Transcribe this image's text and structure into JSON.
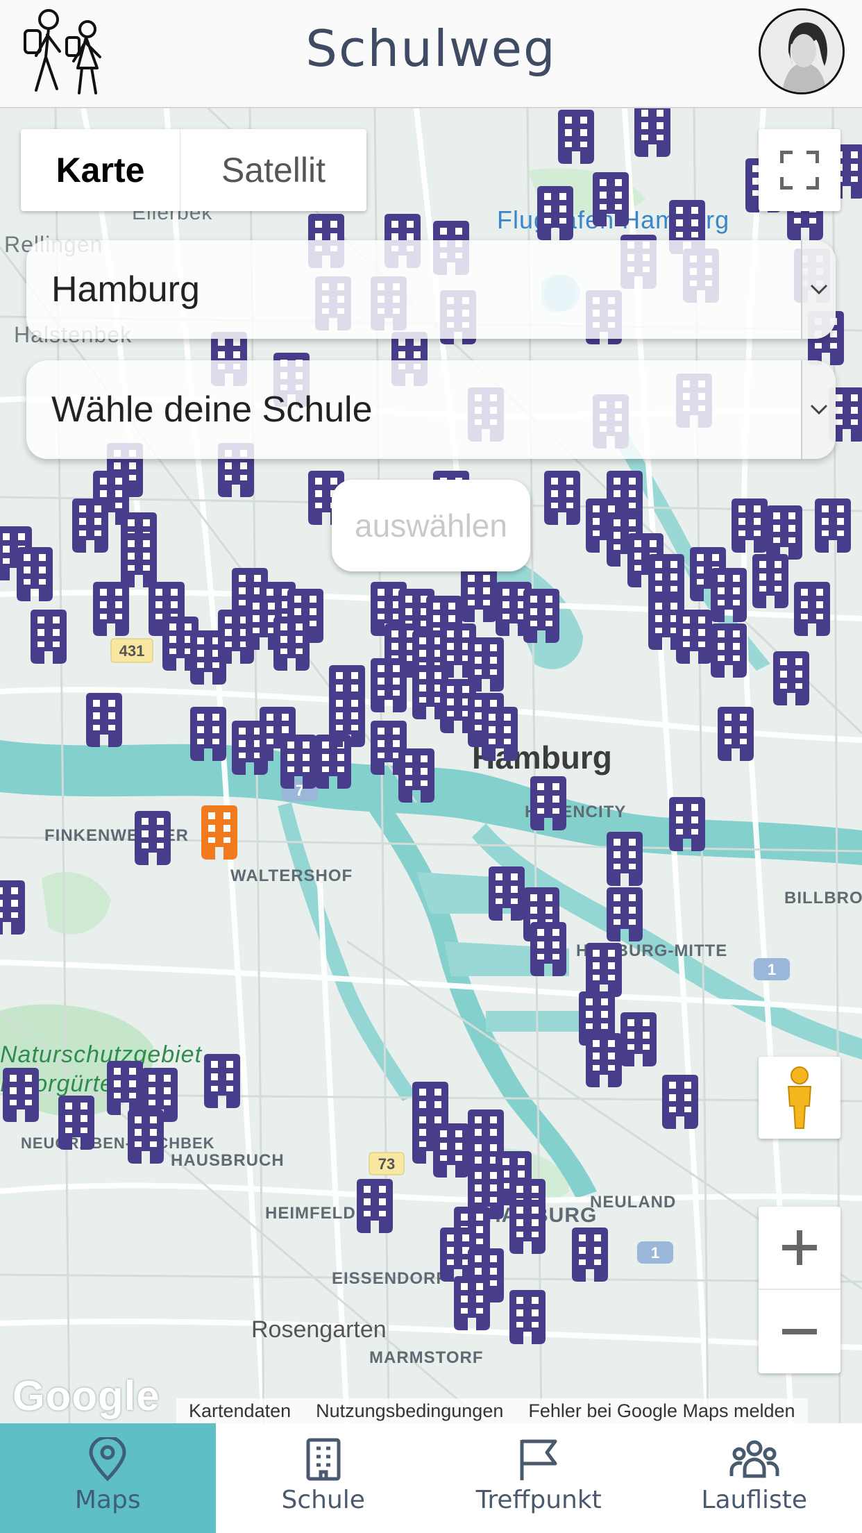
{
  "header": {
    "title": "Schulweg"
  },
  "map": {
    "map_type_buttons": [
      "Karte",
      "Satellit"
    ],
    "city_select_value": "Hamburg",
    "school_select_placeholder": "Wähle deine Schule",
    "choose_button_label": "auswählen",
    "place_labels": [
      "Ellerbek",
      "Rellingen",
      "Halstenbek",
      "Flughafen Hamburg",
      "Hamburg",
      "HAFENCITY",
      "FINKENWERDER",
      "WALTERSHOF",
      "BILLBROOK",
      "HAMBURG-MITTE",
      "Naturschutzgebiet Moorgürtel",
      "NEUGRABEN-FISCHBEK",
      "HAUSBRUCH",
      "HEIMFELD",
      "HARBURG",
      "NEULAND",
      "EISSENDORF",
      "Rosengarten",
      "MARMSTORF"
    ],
    "road_shields": [
      "431",
      "7",
      "73",
      "1"
    ],
    "attribution": [
      "Kartendaten",
      "Nutzungsbedingungen",
      "Fehler bei Google Maps melden"
    ],
    "google_logo": "Google",
    "zoom_in": "+",
    "zoom_out": "−",
    "marker_color": "#473d8b",
    "selected_marker_color": "#f07a1d",
    "water_color": "#83d0cd"
  },
  "bottom_nav": {
    "items": [
      {
        "label": "Maps",
        "icon": "map-pin-icon",
        "active": true
      },
      {
        "label": "Schule",
        "icon": "school-building-icon",
        "active": false
      },
      {
        "label": "Treffpunkt",
        "icon": "flag-icon",
        "active": false
      },
      {
        "label": "Laufliste",
        "icon": "group-icon",
        "active": false
      }
    ],
    "active_color": "#5fbfc6"
  }
}
